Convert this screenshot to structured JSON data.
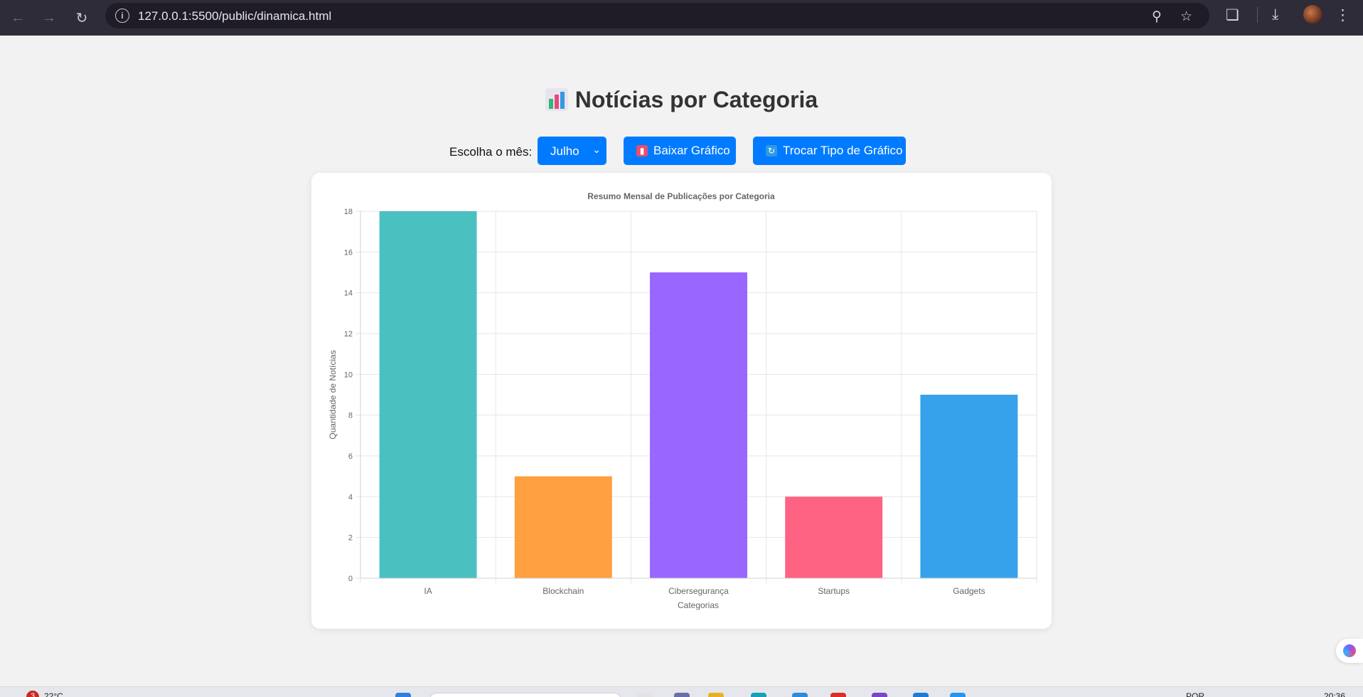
{
  "browser": {
    "url": "127.0.0.1:5500/public/dinamica.html",
    "info_glyph": "i"
  },
  "page": {
    "title": "Notícias por Categoria",
    "month_label": "Escolha o mês:",
    "month_selected": "Julho",
    "download_button": "Baixar Gráfico",
    "toggle_button": "Trocar Tipo de Gráfico"
  },
  "chart_data": {
    "type": "bar",
    "title": "Resumo Mensal de Publicações por Categoria",
    "xlabel": "Categorias",
    "ylabel": "Quantidade de Notícias",
    "categories": [
      "IA",
      "Blockchain",
      "Cibersegurança",
      "Startups",
      "Gadgets"
    ],
    "values": [
      18,
      5,
      15,
      4,
      9
    ],
    "colors": [
      "#4bc0c0",
      "#ff9f40",
      "#9966ff",
      "#ff6384",
      "#36a2eb"
    ],
    "ylim": [
      0,
      18
    ],
    "yticks": [
      0,
      2,
      4,
      6,
      8,
      10,
      12,
      14,
      16,
      18
    ],
    "grid": true,
    "legend": "none"
  },
  "taskbar": {
    "badge": "3",
    "temperature": "22°C",
    "language": "POR",
    "time": "20:36"
  }
}
